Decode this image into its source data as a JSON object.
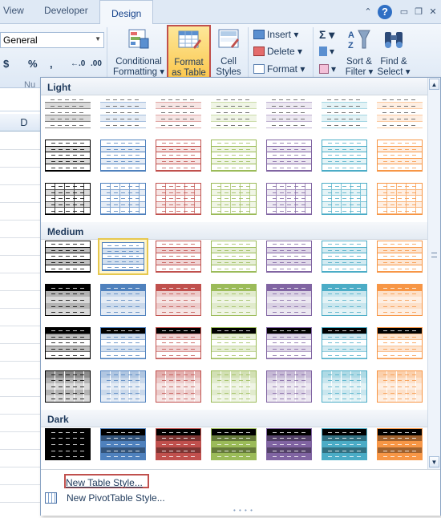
{
  "tabs": [
    {
      "label": "View",
      "active": false
    },
    {
      "label": "Developer",
      "active": false
    },
    {
      "label": "Design",
      "active": true
    }
  ],
  "number_group": {
    "format_value": "General",
    "currency_symbol": "$",
    "percent_symbol": "%",
    "comma_symbol": ",",
    "increase_decimal": "←.0",
    "decrease_decimal": ".00",
    "group_label": "Nu"
  },
  "styles_group": {
    "conditional_formatting": {
      "line1": "Conditional",
      "line2": "Formatting ▾"
    },
    "format_as_table": {
      "line1": "Format",
      "line2": "as Table ▾"
    },
    "cell_styles": {
      "line1": "Cell",
      "line2": "Styles ▾"
    }
  },
  "cells_group": {
    "insert": "Insert ▾",
    "delete": "Delete ▾",
    "format": "Format ▾"
  },
  "editing_group": {
    "autosum": "Σ ▾",
    "fill": "▾",
    "clear": "▾",
    "sort_filter": {
      "line1": "Sort &",
      "line2": "Filter ▾"
    },
    "find_select": {
      "line1": "Find &",
      "line2": "Select ▾"
    }
  },
  "sheet": {
    "column_header": "D"
  },
  "gallery": {
    "sections": [
      "Light",
      "Medium",
      "Dark"
    ],
    "colors": {
      "black": "#000000",
      "blue": "#4f81bd",
      "red": "#c0504d",
      "green": "#9bbb59",
      "purple": "#8064a2",
      "aqua": "#4bacc6",
      "orange": "#f79646"
    },
    "columns": [
      "black",
      "blue",
      "red",
      "green",
      "purple",
      "aqua",
      "orange"
    ],
    "selected_style": "Medium row 1, column 2",
    "footer": {
      "new_table_style": "New Table Style...",
      "new_pivot_style": "New PivotTable Style..."
    }
  }
}
